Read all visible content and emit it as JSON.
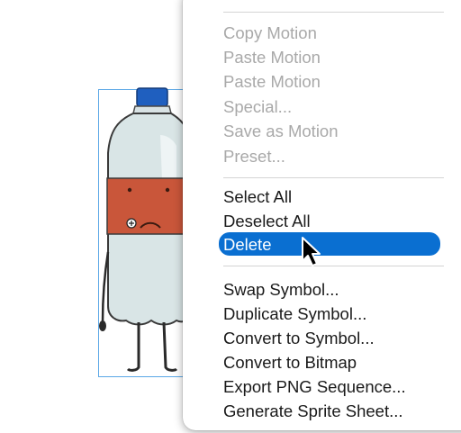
{
  "menu": {
    "group_motion": [
      {
        "label": "Copy Motion",
        "enabled": false
      },
      {
        "label": "Paste Motion",
        "enabled": false
      },
      {
        "label": "Paste Motion",
        "enabled": false
      },
      {
        "label": "Special...",
        "enabled": false
      },
      {
        "label": "Save as Motion",
        "enabled": false
      },
      {
        "label": "Preset...",
        "enabled": false
      }
    ],
    "group_select": [
      {
        "label": "Select All",
        "enabled": true
      },
      {
        "label": "Deselect All",
        "enabled": true
      },
      {
        "label": "Delete",
        "enabled": true,
        "highlighted": true
      }
    ],
    "group_symbol": [
      {
        "label": "Swap Symbol...",
        "enabled": true
      },
      {
        "label": "Duplicate Symbol...",
        "enabled": true
      },
      {
        "label": "Convert to Symbol...",
        "enabled": true
      },
      {
        "label": "Convert to Bitmap",
        "enabled": true
      },
      {
        "label": "Export PNG Sequence...",
        "enabled": true
      },
      {
        "label": "Generate Sprite Sheet...",
        "enabled": true
      }
    ]
  },
  "colors": {
    "highlight": "#0a6fd1",
    "disabled_text": "#a9a9a9",
    "enabled_text": "#1a1a1a",
    "selection_outline": "#5aa7e6",
    "bottle_cap": "#1f5fbf",
    "bottle_label": "#c9563a"
  },
  "canvas": {
    "selected_object": "bottle-character",
    "cursor": "arrow-cursor"
  }
}
